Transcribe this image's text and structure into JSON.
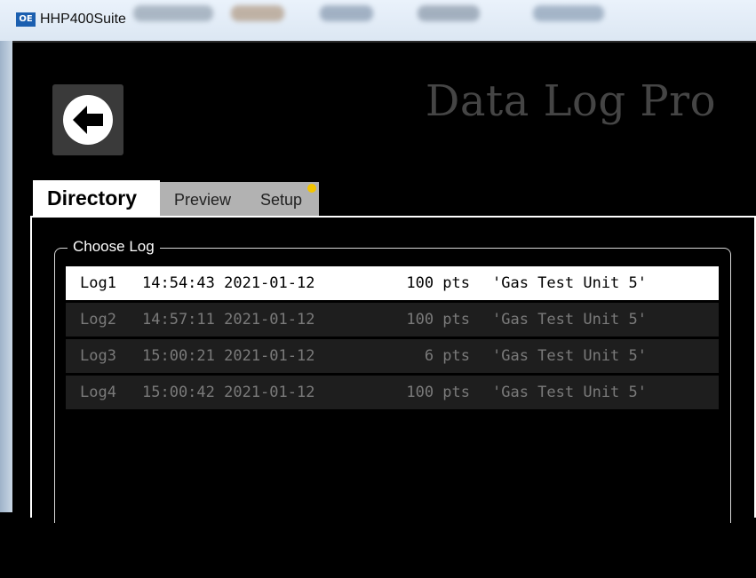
{
  "window": {
    "title": "HHP400Suite",
    "icon_text": "OE"
  },
  "header": {
    "back_icon": "back-arrow-icon",
    "app_title": "Data Log Pro"
  },
  "tabs": [
    {
      "label": "Directory",
      "active": true
    },
    {
      "label": "Preview",
      "active": false
    },
    {
      "label": "Setup",
      "active": false,
      "badge_color": "#f2c400"
    }
  ],
  "group_title": "Choose Log",
  "logs": [
    {
      "name": "Log1",
      "timestamp": "14:54:43 2021-01-12",
      "points": "100 pts",
      "description": "'Gas Test Unit 5'",
      "selected": true
    },
    {
      "name": "Log2",
      "timestamp": "14:57:11 2021-01-12",
      "points": "100 pts",
      "description": "'Gas Test Unit 5'",
      "selected": false
    },
    {
      "name": "Log3",
      "timestamp": "15:00:21 2021-01-12",
      "points": "6 pts",
      "description": "'Gas Test Unit 5'",
      "selected": false
    },
    {
      "name": "Log4",
      "timestamp": "15:00:42 2021-01-12",
      "points": "100 pts",
      "description": "'Gas Test Unit 5'",
      "selected": false
    }
  ],
  "colors": {
    "background": "#000000",
    "tab_inactive": "#b2b2b2",
    "row_bg": "#1e1e1e",
    "row_text": "#7a7a7a",
    "title_text": "#454545"
  }
}
